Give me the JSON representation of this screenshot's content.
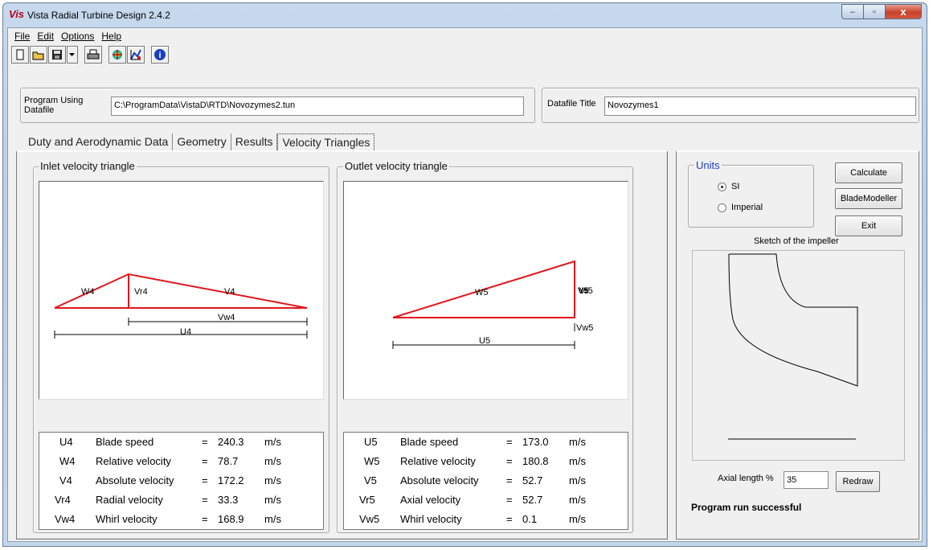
{
  "window": {
    "app_logo": "Vis",
    "title": "Vista Radial Turbine Design 2.4.2",
    "minimize": "–",
    "maximize": "▫",
    "close": "x"
  },
  "menu": {
    "file": "File",
    "edit": "Edit",
    "options": "Options",
    "help": "Help"
  },
  "toolbar": {
    "icons": [
      "new-icon",
      "open-icon",
      "save-icon",
      "dropdown-icon",
      "print-icon",
      "turbine-icon",
      "chart-icon",
      "info-icon"
    ]
  },
  "header": {
    "program_label": "Program Using\nDatafile",
    "program_path": "C:\\ProgramData\\VistaD\\RTD\\Novozymes2.tun",
    "datafile_title_label": "Datafile Title",
    "datafile_title": "Novozymes1"
  },
  "tabs": [
    "Duty and Aerodynamic Data",
    "Geometry",
    "Results",
    "Velocity Triangles"
  ],
  "inlet": {
    "title": "Inlet velocity triangle",
    "labels": {
      "w": "W4",
      "vr": "Vr4",
      "v": "V4",
      "vw": "Vw4",
      "u": "U4"
    },
    "rows": [
      {
        "sym": "U4",
        "name": "Blade speed",
        "eq": "=",
        "val": "240.3",
        "unit": "m/s"
      },
      {
        "sym": "W4",
        "name": "Relative velocity",
        "eq": "=",
        "val": "78.7",
        "unit": "m/s"
      },
      {
        "sym": "V4",
        "name": "Absolute velocity",
        "eq": "=",
        "val": "172.2",
        "unit": "m/s"
      },
      {
        "sym": "Vr4",
        "name": "Radial velocity",
        "eq": "=",
        "val": "33.3",
        "unit": "m/s"
      },
      {
        "sym": "Vw4",
        "name": "Whirl velocity",
        "eq": "=",
        "val": "168.9",
        "unit": "m/s"
      }
    ]
  },
  "outlet": {
    "title": "Outlet velocity triangle",
    "labels": {
      "w": "W5",
      "v": "V5",
      "vr": "Vr5",
      "vw": "Vw5",
      "u": "U5"
    },
    "rows": [
      {
        "sym": "U5",
        "name": "Blade speed",
        "eq": "=",
        "val": "173.0",
        "unit": "m/s"
      },
      {
        "sym": "W5",
        "name": "Relative velocity",
        "eq": "=",
        "val": "180.8",
        "unit": "m/s"
      },
      {
        "sym": "V5",
        "name": "Absolute velocity",
        "eq": "=",
        "val": "52.7",
        "unit": "m/s"
      },
      {
        "sym": "Vr5",
        "name": "Axial velocity",
        "eq": "=",
        "val": "52.7",
        "unit": "m/s"
      },
      {
        "sym": "Vw5",
        "name": "Whirl velocity",
        "eq": "=",
        "val": "0.1",
        "unit": "m/s"
      }
    ]
  },
  "side": {
    "units_title": "Units",
    "unit_si": "SI",
    "unit_imperial": "Imperial",
    "selected_unit": "SI",
    "calculate": "Calculate",
    "blade_modeller": "BladeModeller",
    "exit": "Exit",
    "sketch_title": "Sketch of the impeller",
    "axial_length_label": "Axial length %",
    "axial_length_value": "35",
    "redraw": "Redraw",
    "status": "Program run successful"
  },
  "colors": {
    "triangle": "#e0161c",
    "title_bar": "#c3d6eb",
    "close_button": "#c7432c"
  }
}
